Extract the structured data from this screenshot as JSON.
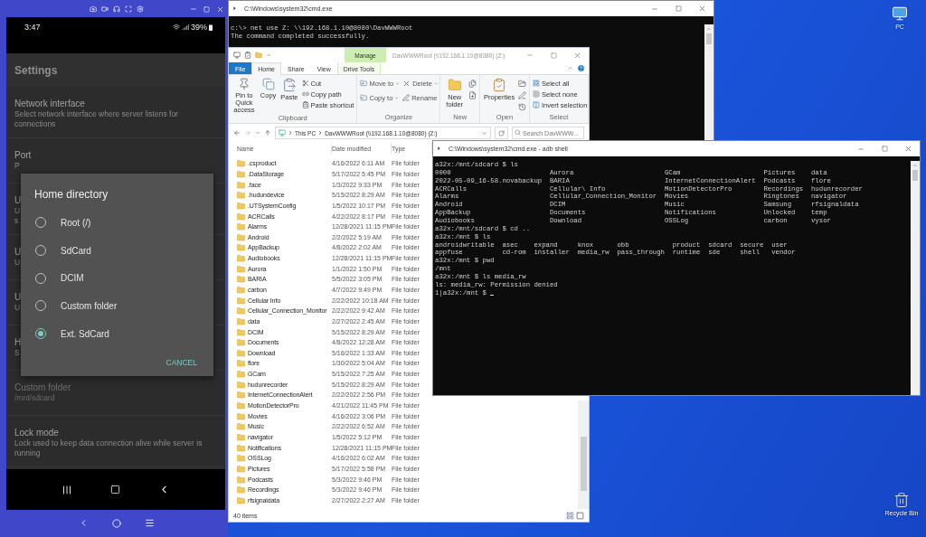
{
  "phone": {
    "status_bar": {
      "time": "3:47",
      "battery": "39%"
    },
    "screen_title": "Settings",
    "settings": [
      {
        "title": "Network interface",
        "summary": "Select network interface where server listens for connections",
        "disabled": false
      },
      {
        "title": "Port",
        "summary": "P",
        "disabled": false
      },
      {
        "title": "U",
        "summary": "U\ns",
        "disabled": false
      },
      {
        "title": "U",
        "summary": "U",
        "disabled": false
      },
      {
        "title": "U",
        "summary": "U",
        "disabled": false
      },
      {
        "title": "H",
        "summary": "S",
        "disabled": false
      },
      {
        "title": "Custom folder",
        "summary": "/mnt/sdcard",
        "disabled": true
      },
      {
        "title": "Lock mode",
        "summary": "Lock used to keep data connection alive while server is running",
        "disabled": false
      }
    ],
    "dialog": {
      "title": "Home directory",
      "options": [
        {
          "label": "Root (/)",
          "selected": false
        },
        {
          "label": "SdCard",
          "selected": false
        },
        {
          "label": "DCIM",
          "selected": false
        },
        {
          "label": "Custom folder",
          "selected": false
        },
        {
          "label": "Ext. SdCard",
          "selected": true
        }
      ],
      "cancel": "CANCEL"
    }
  },
  "cmd_window": {
    "title": "C:\\Windows\\system32\\cmd.exe",
    "lines": [
      "c:\\> net use Z: \\\\192.168.1.10@8080\\DavWWWRoot",
      "The command completed successfully."
    ]
  },
  "explorer": {
    "manage_tab": "Manage",
    "title": "DavWWWRoot (\\\\192.168.1.10@8080) (Z:)",
    "tabs": [
      {
        "label": "File",
        "selected": false,
        "kind": "file"
      },
      {
        "label": "Home",
        "selected": true,
        "kind": "plain"
      },
      {
        "label": "Share",
        "selected": false,
        "kind": "plain"
      },
      {
        "label": "View",
        "selected": false,
        "kind": "plain"
      },
      {
        "label": "Drive Tools",
        "selected": false,
        "kind": "contextual"
      }
    ],
    "ribbon": [
      {
        "name": "Clipboard",
        "commands": [
          {
            "label": "Pin to Quick access",
            "kind": "large"
          },
          {
            "label": "Copy",
            "kind": "large"
          },
          {
            "label": "Paste",
            "kind": "large"
          },
          {
            "label": "Cut",
            "kind": "small"
          },
          {
            "label": "Copy path",
            "kind": "small"
          },
          {
            "label": "Paste shortcut",
            "kind": "small"
          }
        ]
      },
      {
        "name": "Organize",
        "commands": [
          {
            "label": "Move to",
            "kind": "small"
          },
          {
            "label": "Copy to",
            "kind": "small"
          },
          {
            "label": "Delete",
            "kind": "small"
          },
          {
            "label": "Rename",
            "kind": "small"
          }
        ]
      },
      {
        "name": "New",
        "commands": [
          {
            "label": "New folder",
            "kind": "large"
          }
        ]
      },
      {
        "name": "Open",
        "commands": [
          {
            "label": "Properties",
            "kind": "large"
          }
        ]
      },
      {
        "name": "Select",
        "commands": [
          {
            "label": "Select all",
            "kind": "small"
          },
          {
            "label": "Select none",
            "kind": "small"
          },
          {
            "label": "Invert selection",
            "kind": "small"
          }
        ]
      }
    ],
    "address": {
      "crumbs": [
        "This PC",
        "DavWWWRoot (\\\\192.168.1.10@8080) (Z:)"
      ]
    },
    "search": {
      "placeholder": "Search DavWWW..."
    },
    "columns": [
      "Name",
      "Date modified",
      "Type"
    ],
    "rows": [
      {
        "name": ".csproduct",
        "date": "4/16/2022 6:11 AM",
        "type": "File folder"
      },
      {
        "name": ".DataStorage",
        "date": "5/17/2022 5:45 PM",
        "type": "File folder"
      },
      {
        "name": ".face",
        "date": "1/3/2022 9:33 PM",
        "type": "File folder"
      },
      {
        "name": ".hudundevice",
        "date": "5/15/2022 8:29 AM",
        "type": "File folder"
      },
      {
        "name": ".UTSystemConfig",
        "date": "1/5/2022 10:17 PM",
        "type": "File folder"
      },
      {
        "name": "ACRCalls",
        "date": "4/22/2022 8:17 PM",
        "type": "File folder"
      },
      {
        "name": "Alarms",
        "date": "12/28/2021 11:15 PM",
        "type": "File folder"
      },
      {
        "name": "Android",
        "date": "2/2/2022 5:19 AM",
        "type": "File folder"
      },
      {
        "name": "AppBackup",
        "date": "4/8/2022 2:02 AM",
        "type": "File folder"
      },
      {
        "name": "Audiobooks",
        "date": "12/28/2021 11:15 PM",
        "type": "File folder"
      },
      {
        "name": "Aurora",
        "date": "1/1/2022 1:50 PM",
        "type": "File folder"
      },
      {
        "name": "BARIA",
        "date": "5/5/2022 3:05 PM",
        "type": "File folder"
      },
      {
        "name": "carbon",
        "date": "4/7/2022 9:49 PM",
        "type": "File folder"
      },
      {
        "name": "Cellular Info",
        "date": "2/22/2022 10:18 AM",
        "type": "File folder"
      },
      {
        "name": "Cellular_Connection_Monitor",
        "date": "2/22/2022 9:42 AM",
        "type": "File folder"
      },
      {
        "name": "data",
        "date": "2/27/2022 2:45 AM",
        "type": "File folder"
      },
      {
        "name": "DCIM",
        "date": "5/15/2022 8:29 AM",
        "type": "File folder"
      },
      {
        "name": "Documents",
        "date": "4/8/2022 12:28 AM",
        "type": "File folder"
      },
      {
        "name": "Download",
        "date": "5/16/2022 1:33 AM",
        "type": "File folder"
      },
      {
        "name": "flore",
        "date": "1/30/2022 5:04 AM",
        "type": "File folder"
      },
      {
        "name": "GCam",
        "date": "5/15/2022 7:25 AM",
        "type": "File folder"
      },
      {
        "name": "hudunrecorder",
        "date": "5/15/2022 8:29 AM",
        "type": "File folder"
      },
      {
        "name": "InternetConnectionAlert",
        "date": "2/22/2022 2:56 PM",
        "type": "File folder"
      },
      {
        "name": "MotionDetectorPro",
        "date": "4/21/2022 11:45 PM",
        "type": "File folder"
      },
      {
        "name": "Movies",
        "date": "4/16/2022 3:06 PM",
        "type": "File folder"
      },
      {
        "name": "Music",
        "date": "2/22/2022 6:52 AM",
        "type": "File folder"
      },
      {
        "name": "navigator",
        "date": "1/5/2022 5:12 PM",
        "type": "File folder"
      },
      {
        "name": "Notifications",
        "date": "12/28/2021 11:15 PM",
        "type": "File folder"
      },
      {
        "name": "OSSLog",
        "date": "4/16/2022 6:02 AM",
        "type": "File folder"
      },
      {
        "name": "Pictures",
        "date": "5/17/2022 5:58 PM",
        "type": "File folder"
      },
      {
        "name": "Podcasts",
        "date": "5/3/2022 9:46 PM",
        "type": "File folder"
      },
      {
        "name": "Recordings",
        "date": "5/3/2022 9:46 PM",
        "type": "File folder"
      },
      {
        "name": "rfsignaldata",
        "date": "2/27/2022 2:27 AM",
        "type": "File folder"
      }
    ],
    "status": "40 items"
  },
  "adb_window": {
    "title": "C:\\Windows\\system32\\cmd.exe - adb  shell",
    "lines": [
      "a32x:/mnt/sdcard $ ls",
      "0000                         Aurora                       GCam                     Pictures    data",
      "2022-05-09_16-58.novabackup  BARIA                        InternetConnectionAlert  Podcasts    flore",
      "ACRCalls                     Cellular\\ Info               MotionDetectorPro        Recordings  hudunrecorder",
      "Alarms                       Cellular_Connection_Monitor  Movies                   Ringtones   navigator",
      "Android                      DCIM                         Music                    Samsung     rfsignaldata",
      "AppBackup                    Documents                    Notifications            Unlocked    temp",
      "Audiobooks                   Download                     OSSLog                   carbon      vysor",
      "a32x:/mnt/sdcard $ cd ..",
      "a32x:/mnt $ ls",
      "androidwritable  asec    expand     knox      obb           product  sdcard  secure  user",
      "appfuse          cd-rom  installer  media_rw  pass_through  runtime  sde     shell   vendor",
      "a32x:/mnt $ pwd",
      "/mnt",
      "a32x:/mnt $ ls media_rw",
      "ls: media_rw: Permission denied",
      "1|a32x:/mnt $ "
    ]
  },
  "desktop_icons": [
    {
      "label": "PC"
    },
    {
      "label": "Recycle Bin"
    }
  ]
}
